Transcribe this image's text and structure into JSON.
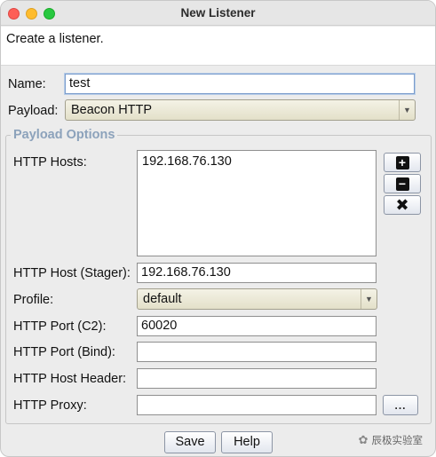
{
  "window": {
    "title": "New Listener"
  },
  "description": "Create a listener.",
  "fields": {
    "name": {
      "label": "Name:",
      "value": "test"
    },
    "payload": {
      "label": "Payload:",
      "value": "Beacon HTTP"
    }
  },
  "payload_options": {
    "title": "Payload Options",
    "http_hosts": {
      "label": "HTTP Hosts:",
      "items": [
        "192.168.76.130"
      ]
    },
    "http_host_stager": {
      "label": "HTTP Host (Stager):",
      "value": "192.168.76.130"
    },
    "profile": {
      "label": "Profile:",
      "value": "default"
    },
    "http_port_c2": {
      "label": "HTTP Port (C2):",
      "value": "60020"
    },
    "http_port_bind": {
      "label": "HTTP Port (Bind):",
      "value": ""
    },
    "http_host_header": {
      "label": "HTTP Host Header:",
      "value": ""
    },
    "http_proxy": {
      "label": "HTTP Proxy:",
      "value": "",
      "browse_label": "..."
    }
  },
  "icons": {
    "add": "plus-icon",
    "remove": "minus-icon",
    "clear": "x-icon",
    "close": "close-dot",
    "minimize": "minimize-dot",
    "zoom": "zoom-dot"
  },
  "buttons": {
    "save": "Save",
    "help": "Help"
  },
  "watermark": "辰极实验室",
  "colors": {
    "group_title": "#8ca2bb",
    "combo_fill": "#ebe8d6",
    "traffic_red": "#fd5f57",
    "traffic_yellow": "#febc2e",
    "traffic_green": "#28c840"
  }
}
